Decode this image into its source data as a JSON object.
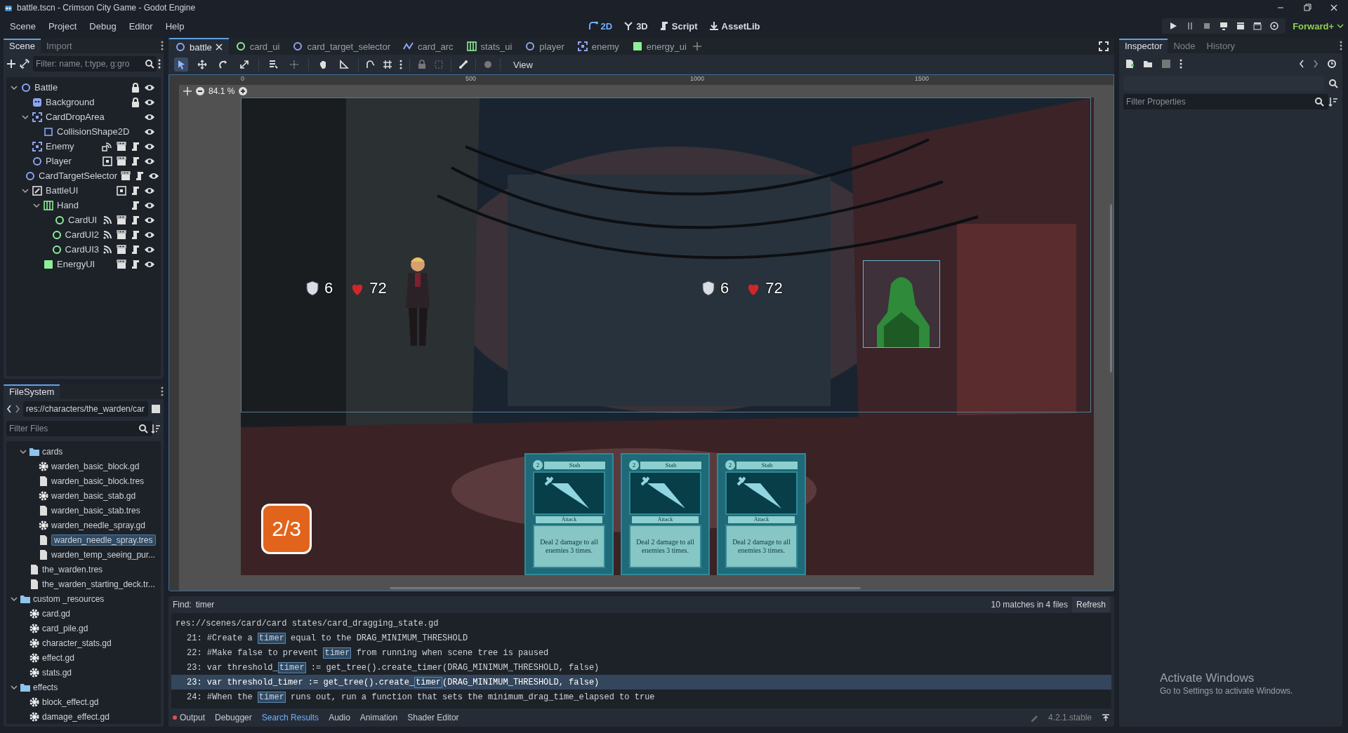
{
  "window": {
    "title": "battle.tscn - Crimson City Game - Godot Engine"
  },
  "menu": [
    "Scene",
    "Project",
    "Debug",
    "Editor",
    "Help"
  ],
  "workspaces": [
    {
      "label": "2D",
      "kind": "flat",
      "selected": true
    },
    {
      "label": "3D",
      "kind": "spatial",
      "selected": false
    },
    {
      "label": "Script",
      "kind": "script",
      "selected": false
    },
    {
      "label": "AssetLib",
      "kind": "assetlib",
      "selected": false
    }
  ],
  "renderer": "Forward+",
  "scene_dock": {
    "tabs": [
      {
        "label": "Scene",
        "selected": true
      },
      {
        "label": "Import",
        "selected": false
      }
    ],
    "filter": {
      "placeholder": "Filter: name, t:type, g:gro"
    },
    "tree": [
      {
        "name": "Battle",
        "kind": "node2d",
        "expanded": true,
        "visible": true,
        "badges": [
          {
            "kind": "lock"
          }
        ],
        "children": [
          {
            "name": "Background",
            "kind": "sprite",
            "visible": true,
            "badges": [
              {
                "kind": "lock"
              }
            ]
          },
          {
            "name": "CardDropArea",
            "kind": "area",
            "expanded": true,
            "visible": true,
            "children": [
              {
                "name": "CollisionShape2D",
                "kind": "collision",
                "visible": true
              }
            ]
          },
          {
            "name": "Enemy",
            "kind": "area",
            "visible": true,
            "badges": [
              {
                "kind": "groups"
              },
              {
                "kind": "scene"
              },
              {
                "kind": "script"
              }
            ]
          },
          {
            "name": "Player",
            "kind": "node2d",
            "visible": true,
            "badges": [
              {
                "kind": "unique"
              },
              {
                "kind": "scene"
              },
              {
                "kind": "script"
              }
            ]
          },
          {
            "name": "CardTargetSelector",
            "kind": "node2d",
            "visible": true,
            "badges": [
              {
                "kind": "scene"
              },
              {
                "kind": "script"
              }
            ]
          },
          {
            "name": "BattleUI",
            "kind": "layer",
            "expanded": true,
            "visible": true,
            "badges": [
              {
                "kind": "unique"
              },
              {
                "kind": "script"
              }
            ],
            "children": [
              {
                "name": "Hand",
                "kind": "hbox",
                "expanded": true,
                "visible": true,
                "badges": [
                  {
                    "kind": "script"
                  }
                ],
                "children": [
                  {
                    "name": "CardUI",
                    "kind": "control",
                    "visible": true,
                    "badges": [
                      {
                        "kind": "signals"
                      },
                      {
                        "kind": "scene"
                      },
                      {
                        "kind": "script"
                      }
                    ]
                  },
                  {
                    "name": "CardUI2",
                    "kind": "control",
                    "visible": true,
                    "badges": [
                      {
                        "kind": "signals"
                      },
                      {
                        "kind": "scene"
                      },
                      {
                        "kind": "script"
                      }
                    ]
                  },
                  {
                    "name": "CardUI3",
                    "kind": "control",
                    "visible": true,
                    "badges": [
                      {
                        "kind": "signals"
                      },
                      {
                        "kind": "scene"
                      },
                      {
                        "kind": "script"
                      }
                    ]
                  }
                ]
              },
              {
                "name": "EnergyUI",
                "kind": "panel",
                "visible": true,
                "badges": [
                  {
                    "kind": "scene"
                  },
                  {
                    "kind": "script"
                  }
                ]
              }
            ]
          }
        ]
      }
    ]
  },
  "filesystem": {
    "title": "FileSystem",
    "path": "res://characters/the_warden/car",
    "filter": {
      "placeholder": "Filter Files"
    },
    "tree": [
      {
        "children": [
          {
            "name": "cards",
            "kind": "folder",
            "expanded": true,
            "selected": false,
            "children": [
              {
                "name": "warden_basic_block.gd",
                "kind": "script",
                "selected": false
              },
              {
                "name": "warden_basic_block.tres",
                "kind": "resource",
                "selected": false
              },
              {
                "name": "warden_basic_stab.gd",
                "kind": "script",
                "selected": false
              },
              {
                "name": "warden_basic_stab.tres",
                "kind": "resource",
                "selected": false
              },
              {
                "name": "warden_needle_spray.gd",
                "kind": "script",
                "selected": false
              },
              {
                "name": "warden_needle_spray.tres",
                "kind": "resource",
                "selected": true
              },
              {
                "name": "warden_temp_seeing_pur...",
                "kind": "resource",
                "selected": false
              }
            ]
          },
          {
            "name": "the_warden.tres",
            "kind": "resource",
            "selected": false
          },
          {
            "name": "the_warden_starting_deck.tr...",
            "kind": "resource",
            "selected": false
          }
        ]
      },
      {
        "name": "custom _resources",
        "kind": "folder",
        "expanded": true,
        "selected": false,
        "children": [
          {
            "name": "card.gd",
            "kind": "script",
            "selected": false
          },
          {
            "name": "card_pile.gd",
            "kind": "script",
            "selected": false
          },
          {
            "name": "character_stats.gd",
            "kind": "script",
            "selected": false
          },
          {
            "name": "effect.gd",
            "kind": "script",
            "selected": false
          },
          {
            "name": "stats.gd",
            "kind": "script",
            "selected": false
          }
        ]
      },
      {
        "name": "effects",
        "kind": "folder",
        "expanded": true,
        "selected": false,
        "children": [
          {
            "name": "block_effect.gd",
            "kind": "script",
            "selected": false
          },
          {
            "name": "damage_effect.gd",
            "kind": "script",
            "selected": false
          }
        ]
      }
    ]
  },
  "editor_tabs": [
    {
      "label": "battle",
      "kind": "node2d",
      "selected": true
    },
    {
      "label": "card_ui",
      "kind": "control",
      "selected": false
    },
    {
      "label": "card_target_selector",
      "kind": "node2d",
      "selected": false
    },
    {
      "label": "card_arc",
      "kind": "line",
      "selected": false
    },
    {
      "label": "stats_ui",
      "kind": "hbox",
      "selected": false
    },
    {
      "label": "player",
      "kind": "node2d",
      "selected": false
    },
    {
      "label": "enemy",
      "kind": "area",
      "selected": false
    },
    {
      "label": "energy_ui",
      "kind": "panel",
      "selected": false
    }
  ],
  "tools": [
    {
      "kind": "select",
      "selected": true
    },
    {
      "kind": "move",
      "selected": false
    },
    {
      "kind": "rotate",
      "selected": false
    },
    {
      "kind": "scale",
      "selected": false
    },
    {
      "kind": "list",
      "selected": false
    },
    {
      "kind": "pivot",
      "selected": false
    },
    {
      "kind": "pan",
      "selected": false
    },
    {
      "kind": "ruler",
      "selected": false
    }
  ],
  "view_menu": "View",
  "zoom": "84.1 %",
  "ruler": [
    "0",
    "500",
    "1000",
    "1500"
  ],
  "game": {
    "kind": "picture",
    "player": {
      "block": "6",
      "health": "72"
    },
    "enemy": {
      "block": "6",
      "health": "72"
    },
    "energy": "2/3",
    "cards": [
      {
        "cost": "2",
        "title": "Stab",
        "type": "Attack",
        "text": "Deal 2 damage to all enemies 3 times."
      },
      {
        "cost": "2",
        "title": "Stab",
        "type": "Attack",
        "text": "Deal 2 damage to all enemies 3 times."
      },
      {
        "cost": "2",
        "title": "Stab",
        "type": "Attack",
        "text": "Deal 2 damage to all enemies 3 times."
      }
    ]
  },
  "search": {
    "label": "Find:",
    "query": "timer",
    "summary": "10 matches in 4 files",
    "refresh": "Refresh",
    "file": "res://scenes/card/card states/card_dragging_state.gd",
    "results": [
      {
        "number": "21:",
        "before": "#Create a ",
        "match": "timer",
        "after": " equal to the DRAG_MINIMUM_THRESHOLD",
        "selected": false
      },
      {
        "number": "22:",
        "before": "#Make false to prevent ",
        "match": "timer",
        "after": " from running when scene tree is paused",
        "selected": false
      },
      {
        "number": "23:",
        "before": "var threshold_",
        "match": "timer",
        "after": " := get_tree().create_timer(DRAG_MINIMUM_THRESHOLD, false)",
        "selected": false
      },
      {
        "number": "23:",
        "before": "var threshold_timer := get_tree().create_",
        "match": "timer",
        "after": "(DRAG_MINIMUM_THRESHOLD, false)",
        "selected": true
      },
      {
        "number": "24:",
        "before": "#When the ",
        "match": "timer",
        "after": " runs out, run a function that sets the minimum_drag_time_elapsed to true",
        "selected": false
      }
    ]
  },
  "bottom_tabs": [
    {
      "label": "Output",
      "selected": false,
      "alert": true
    },
    {
      "label": "Debugger",
      "selected": false,
      "alert": false
    },
    {
      "label": "Search Results",
      "selected": true,
      "alert": false
    },
    {
      "label": "Audio",
      "selected": false,
      "alert": false
    },
    {
      "label": "Animation",
      "selected": false,
      "alert": false
    },
    {
      "label": "Shader Editor",
      "selected": false,
      "alert": false
    }
  ],
  "version": "4.2.1.stable",
  "inspector": {
    "tabs": [
      {
        "label": "Inspector",
        "selected": true
      },
      {
        "label": "Node",
        "selected": false
      },
      {
        "label": "History",
        "selected": false
      }
    ],
    "filter": {
      "placeholder": "Filter Properties"
    }
  },
  "activation": {
    "title": "Activate Windows",
    "text": "Go to Settings to activate Windows."
  }
}
